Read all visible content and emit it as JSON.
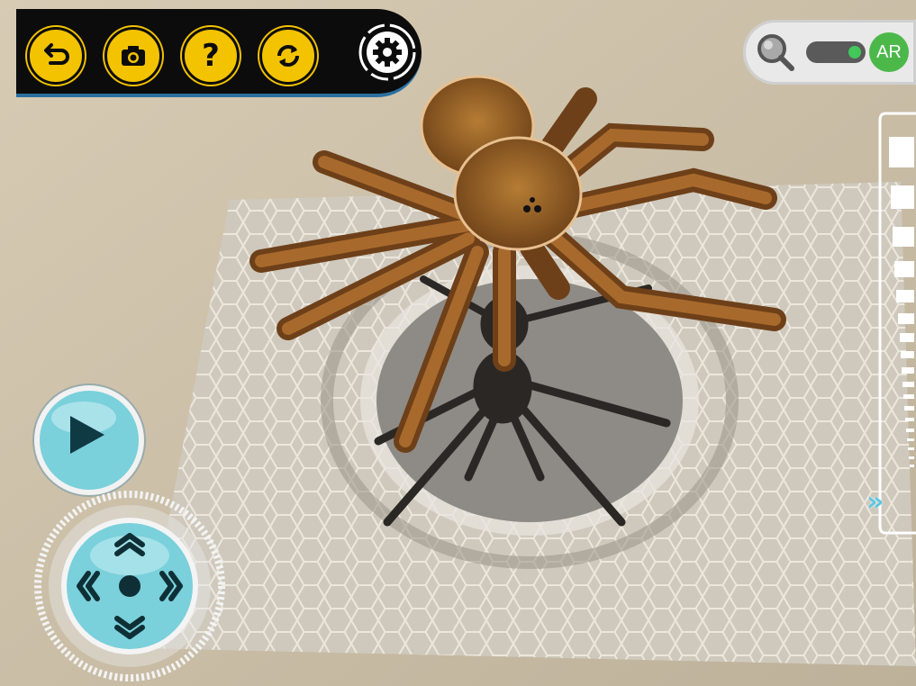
{
  "toolbar": {
    "buttons": [
      {
        "name": "back-button",
        "icon": "back-arrow-icon"
      },
      {
        "name": "camera-button",
        "icon": "camera-icon"
      },
      {
        "name": "help-button",
        "icon": "question-icon"
      },
      {
        "name": "refresh-button",
        "icon": "refresh-icon"
      },
      {
        "name": "settings-button",
        "icon": "gear-icon"
      }
    ],
    "help_glyph": "?"
  },
  "ar_toggle": {
    "label": "AR",
    "enabled": true,
    "search_icon": "magnifier-icon"
  },
  "side_panel": {
    "expand_glyph": "»"
  },
  "controls": {
    "play_icon": "play-icon",
    "dpad_icons": [
      "chevron-up-icon",
      "chevron-down-icon",
      "chevron-left-icon",
      "chevron-right-icon",
      "center-dot-icon"
    ]
  },
  "colors": {
    "toolbar_bg": "#0c0c0c",
    "toolbar_icon": "#f3c300",
    "ar_green": "#4cb84a",
    "control_teal": "#7ad0db"
  }
}
